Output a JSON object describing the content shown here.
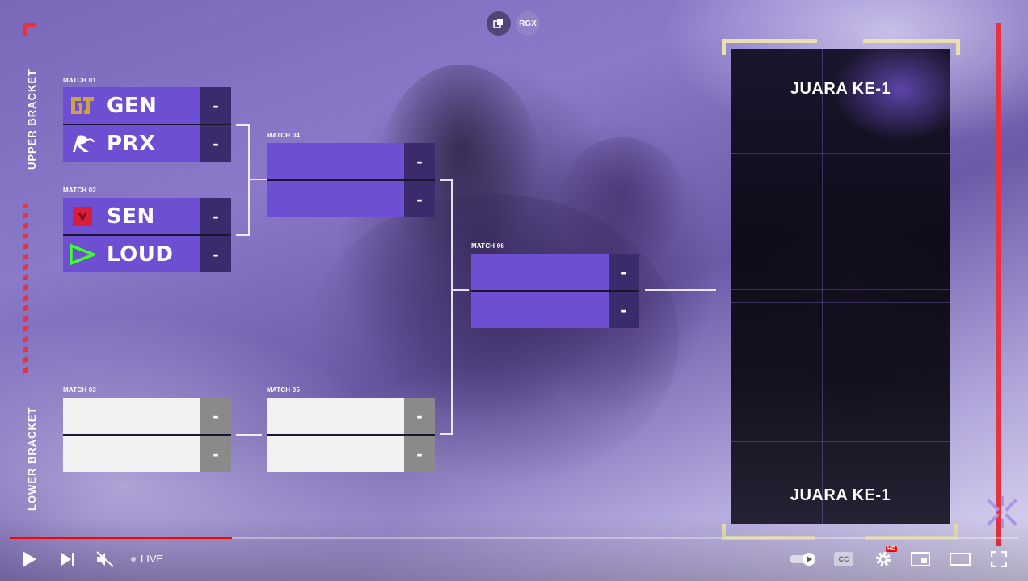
{
  "top_bar": {
    "copy_icon": "copy-icon",
    "channel_badge": "RGX"
  },
  "bracket": {
    "upper_label": "UPPER BRACKET",
    "lower_label": "LOWER BRACKET",
    "matches": [
      {
        "label": "MATCH 01",
        "teams": [
          {
            "name": "GEN",
            "score": "-",
            "logo": "gen-logo"
          },
          {
            "name": "PRX",
            "score": "-",
            "logo": "prx-logo"
          }
        ]
      },
      {
        "label": "MATCH 02",
        "teams": [
          {
            "name": "SEN",
            "score": "-",
            "logo": "sen-logo"
          },
          {
            "name": "LOUD",
            "score": "-",
            "logo": "loud-logo"
          }
        ]
      },
      {
        "label": "MATCH 03",
        "teams": [
          {
            "name": "",
            "score": "-"
          },
          {
            "name": "",
            "score": "-"
          }
        ]
      },
      {
        "label": "MATCH 04",
        "teams": [
          {
            "name": "",
            "score": "-"
          },
          {
            "name": "",
            "score": "-"
          }
        ]
      },
      {
        "label": "MATCH 05",
        "teams": [
          {
            "name": "",
            "score": "-"
          },
          {
            "name": "",
            "score": "-"
          }
        ]
      },
      {
        "label": "MATCH 06",
        "teams": [
          {
            "name": "",
            "score": "-"
          },
          {
            "name": "",
            "score": "-"
          }
        ]
      }
    ]
  },
  "champion_panel": {
    "title_top": "JUARA KE-1",
    "title_bottom": "JUARA KE-1"
  },
  "colors": {
    "team_purple": "#6e4fd2",
    "score_dark": "#3a2c6c",
    "accent_red": "#e8333f",
    "frame_gold": "#e9dfb0"
  },
  "player": {
    "progress_fraction": 0.22,
    "live_label": "LIVE",
    "hd_badge": "HD",
    "cc_label": "CC",
    "icons": [
      "play-icon",
      "next-icon",
      "mute-icon",
      "autoplay-toggle-icon",
      "captions-icon",
      "settings-icon",
      "miniplayer-icon",
      "theater-icon",
      "fullscreen-icon"
    ]
  }
}
